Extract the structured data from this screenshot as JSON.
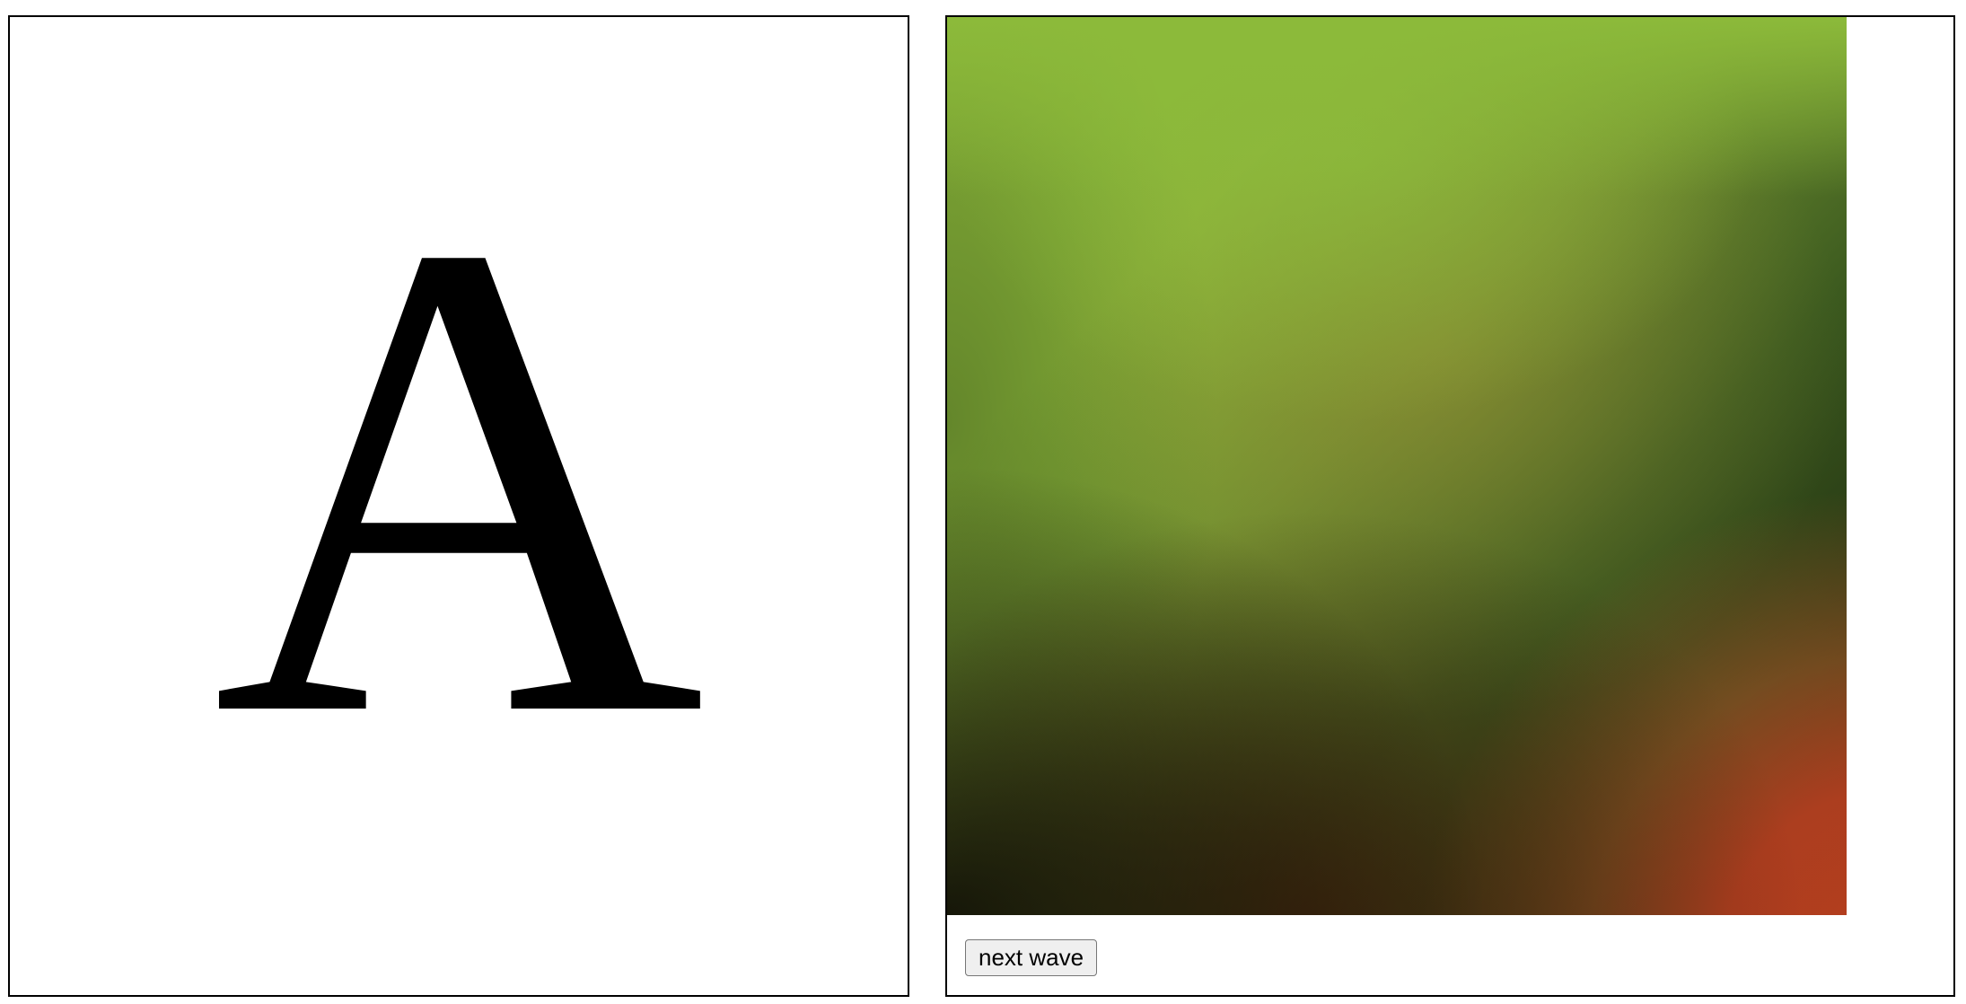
{
  "left_panel": {
    "glyph": "A"
  },
  "right_panel": {
    "gradient_colors": {
      "top_green": "#8cb83a",
      "mid_olive": "#9a7b2e",
      "bottom_right_red": "#b63e1e",
      "bottom_left_dark": "#0f1307"
    },
    "next_wave_button": {
      "label": "next wave"
    }
  }
}
